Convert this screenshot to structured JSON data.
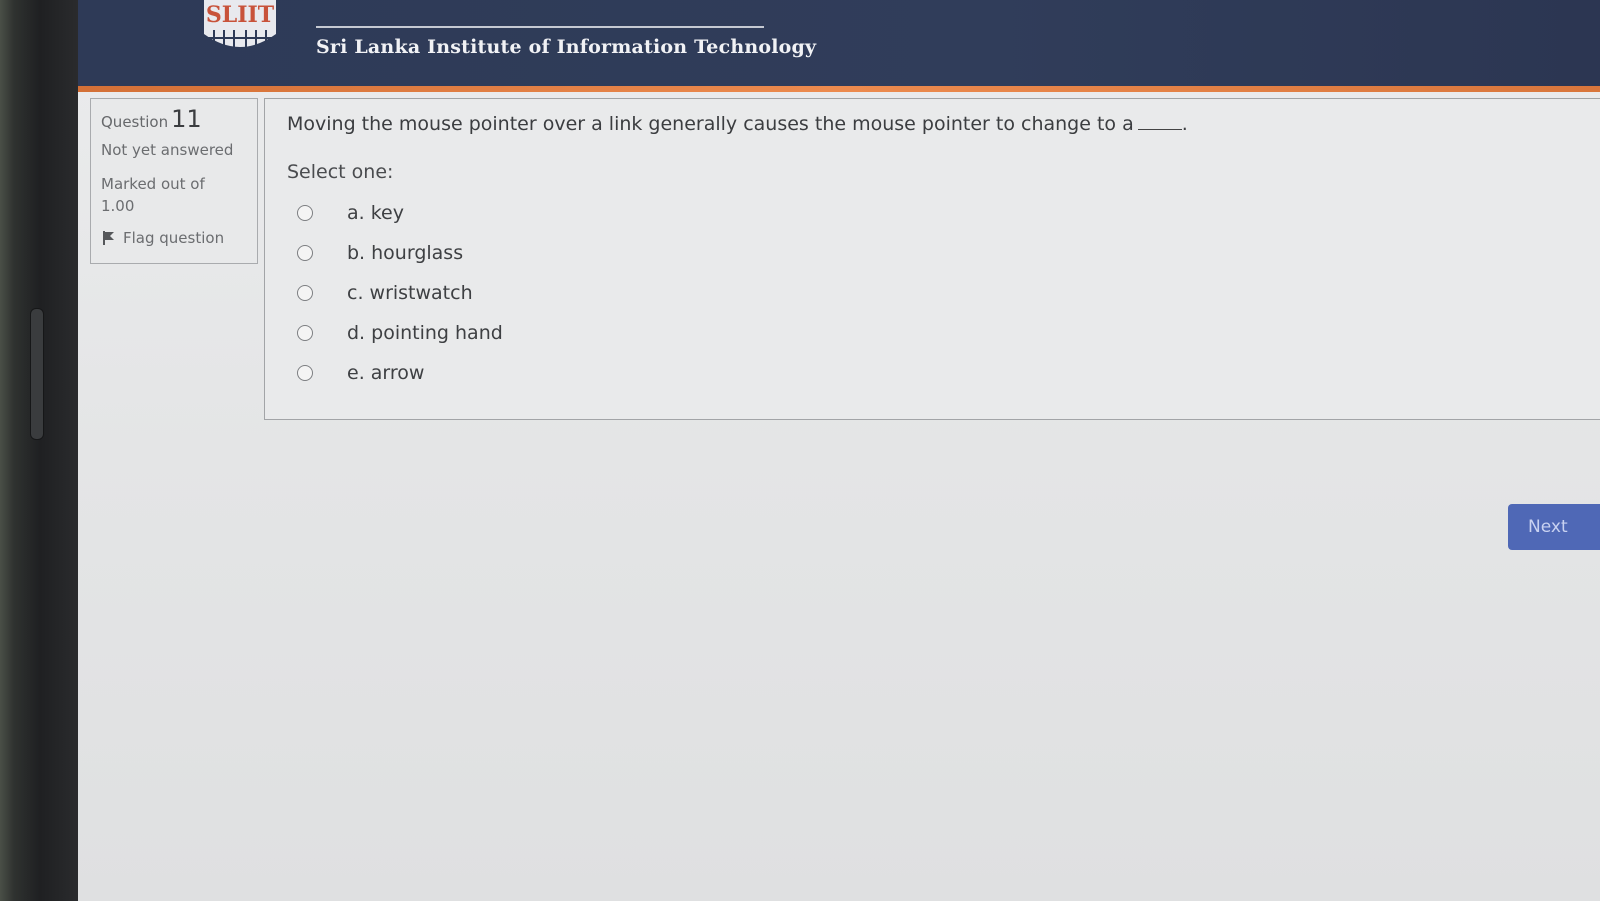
{
  "header": {
    "institution": "Sri Lanka Institute of Information Technology",
    "logo_text": "SLIIT"
  },
  "question_info": {
    "label": "Question",
    "number": "11",
    "state": "Not yet answered",
    "grade": "Marked out of 1.00",
    "flag_label": "Flag question"
  },
  "question": {
    "text": "Moving the mouse pointer over a link generally causes the mouse pointer to change to a",
    "trailing": ".",
    "prompt": "Select one:",
    "answers": [
      {
        "label": "a. key"
      },
      {
        "label": "b. hourglass"
      },
      {
        "label": "c. wristwatch"
      },
      {
        "label": "d. pointing hand"
      },
      {
        "label": "e. arrow"
      }
    ]
  },
  "navigation": {
    "next_label": "Next"
  },
  "colors": {
    "header_bg": "#2e3a57",
    "accent": "#e07c41",
    "button": "#4f68b6"
  }
}
